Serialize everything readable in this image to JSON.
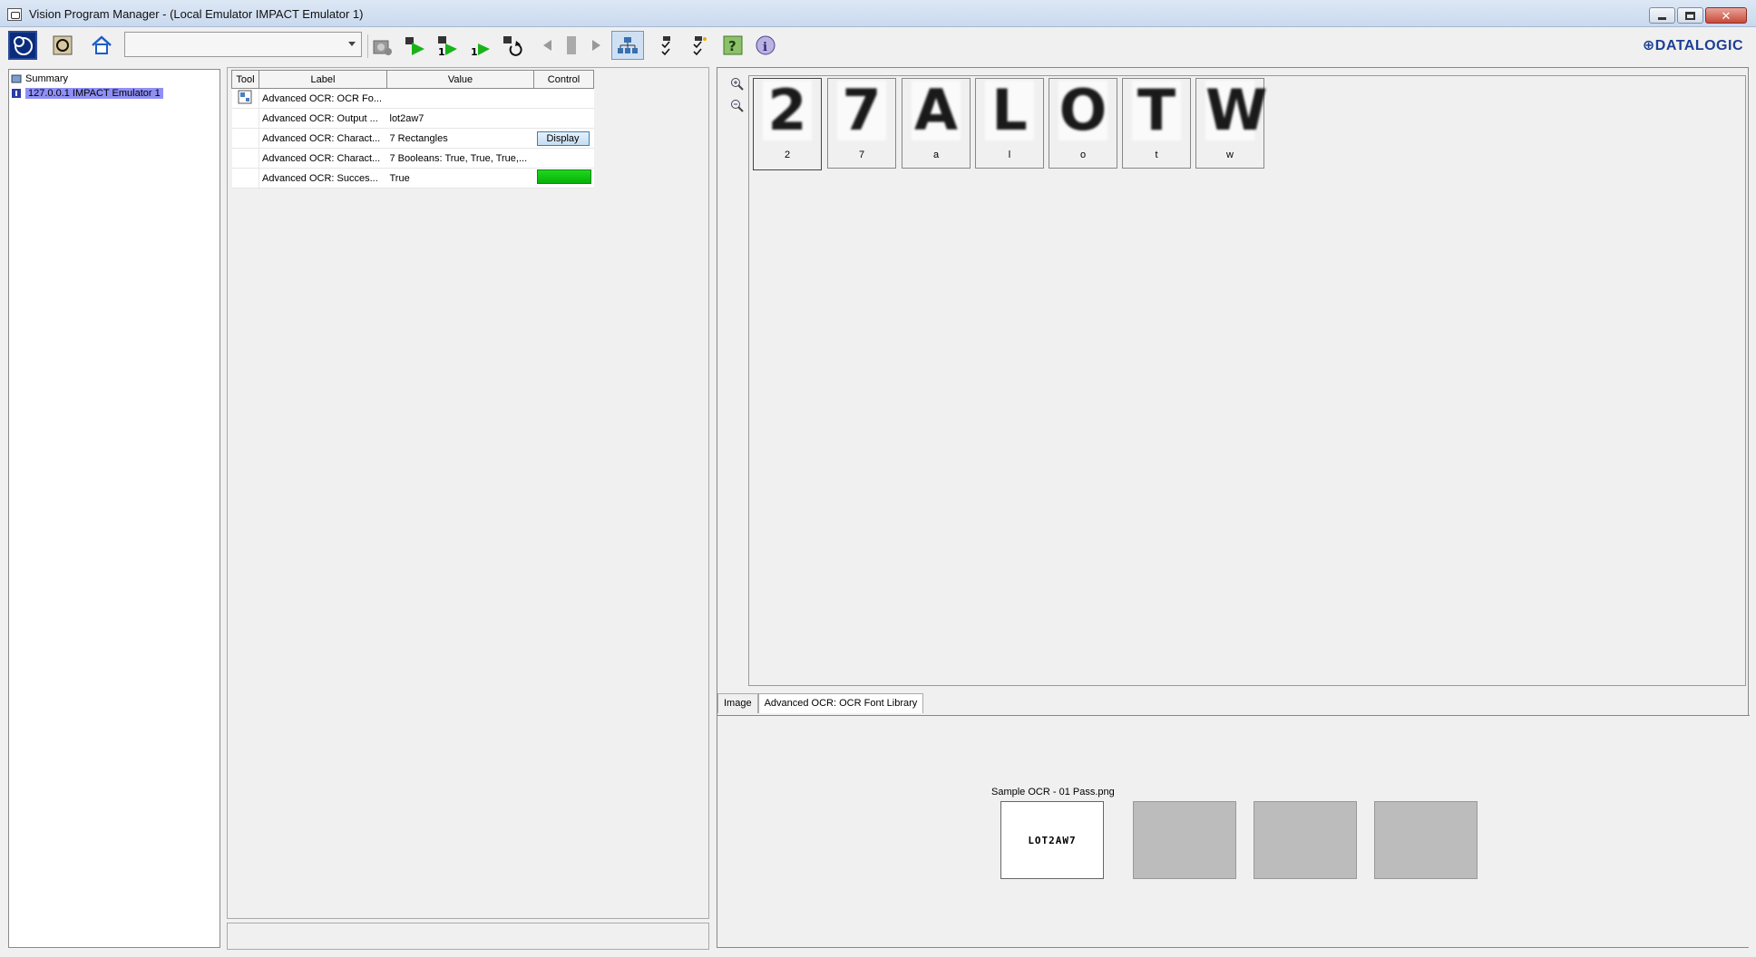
{
  "window": {
    "title": "Vision Program Manager - (Local Emulator IMPACT Emulator 1)"
  },
  "toolbar": {
    "brand": "⊕DATALOGIC",
    "program_select": ""
  },
  "tree": {
    "items": [
      {
        "label": "Summary"
      },
      {
        "label": "127.0.0.1 IMPACT Emulator 1"
      }
    ]
  },
  "results": {
    "columns": [
      "Tool",
      "Label",
      "Value",
      "Control"
    ],
    "rows": [
      {
        "label": "Advanced OCR: OCR Fo...",
        "value": "",
        "control": ""
      },
      {
        "label": "Advanced OCR: Output ...",
        "value": "lot2aw7",
        "control": ""
      },
      {
        "label": "Advanced OCR: Charact...",
        "value": "7 Rectangles",
        "control": "Display"
      },
      {
        "label": "Advanced OCR: Charact...",
        "value": "7 Booleans: True, True, True,...",
        "control": ""
      },
      {
        "label": "Advanced OCR: Succes...",
        "value": "True",
        "control": ""
      }
    ]
  },
  "viewer": {
    "characters": [
      {
        "glyph": "2",
        "label": "2"
      },
      {
        "glyph": "7",
        "label": "7"
      },
      {
        "glyph": "A",
        "label": "a"
      },
      {
        "glyph": "L",
        "label": "l"
      },
      {
        "glyph": "O",
        "label": "o"
      },
      {
        "glyph": "T",
        "label": "t"
      },
      {
        "glyph": "W",
        "label": "w"
      }
    ],
    "tabs": [
      "Image",
      "Advanced OCR: OCR Font Library"
    ],
    "filmstrip_title": "Sample OCR - 01 Pass.png",
    "thumb_text": "LOT2AW7"
  },
  "colors": {
    "selection": "#8f8ff5",
    "pass": "#10c010",
    "brand": "#1c3f94"
  }
}
